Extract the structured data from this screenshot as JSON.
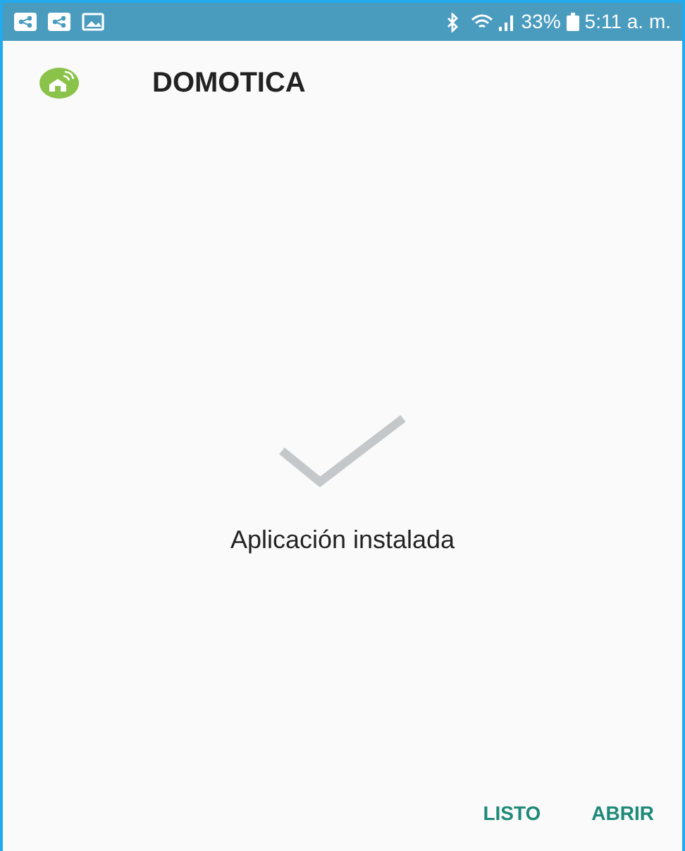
{
  "status_bar": {
    "battery": "33%",
    "time": "5:11 a. m."
  },
  "app": {
    "title": "DOMOTICA"
  },
  "message": "Aplicación instalada",
  "buttons": [
    {
      "label": "LISTO"
    },
    {
      "label": "ABRIR"
    }
  ]
}
